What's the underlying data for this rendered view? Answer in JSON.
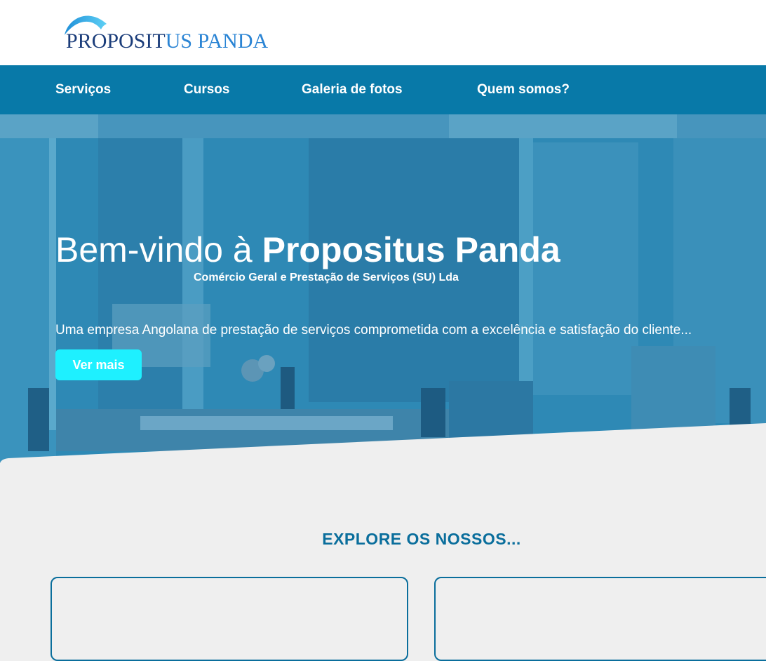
{
  "brand": {
    "logo_text_main": "PROPOSIT",
    "logo_text_accent": "US PANDA",
    "colors": {
      "navy": "#1b3d7a",
      "blue": "#2a84d4",
      "nav_bg": "#0879a8",
      "cta": "#1ef0ff",
      "section_title": "#0a6e9c"
    }
  },
  "nav": {
    "items": [
      {
        "label": "Serviços"
      },
      {
        "label": "Cursos"
      },
      {
        "label": "Galeria de fotos"
      },
      {
        "label": "Quem somos?"
      }
    ]
  },
  "hero": {
    "title_prefix": "Bem-vindo à ",
    "title_brand": "Propositus Panda",
    "subtitle": "Comércio Geral e Prestação de Serviços (SU) Lda",
    "description": "Uma empresa Angolana de prestação de serviços comprometida com a excelência e satisfação do cliente...",
    "cta_label": "Ver mais"
  },
  "explore": {
    "title": "EXPLORE OS NOSSOS..."
  }
}
